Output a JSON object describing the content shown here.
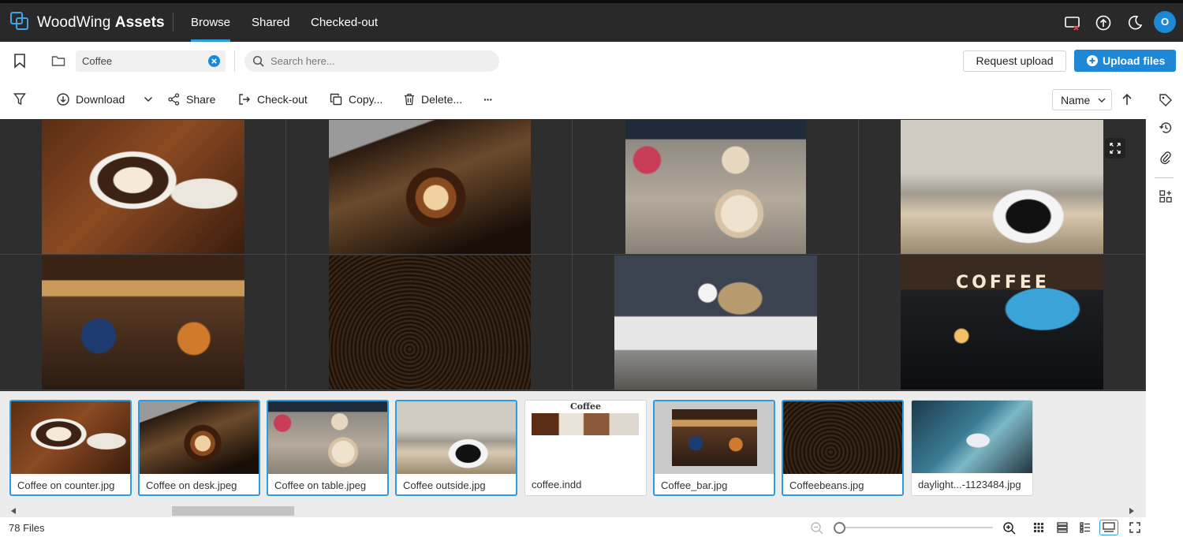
{
  "app": {
    "brand_regular": "WoodWing ",
    "brand_bold": "Assets",
    "nav": [
      {
        "label": "Browse",
        "active": true
      },
      {
        "label": "Shared",
        "active": false
      },
      {
        "label": "Checked-out",
        "active": false
      }
    ],
    "avatar_initial": "O",
    "accent_color": "#1e88d6",
    "icons": [
      "no-cast-icon",
      "upload-cloud-icon",
      "dark-mode-icon"
    ]
  },
  "search_row": {
    "folder_chip": "Coffee",
    "search_placeholder": "Search here...",
    "search_value": "",
    "request_upload": "Request upload",
    "upload_files": "Upload files"
  },
  "toolbar": {
    "download": "Download",
    "share": "Share",
    "checkout": "Check-out",
    "copy": "Copy...",
    "delete": "Delete...",
    "more": "···",
    "sort_by": "Name"
  },
  "preview_grid": {
    "banner_text": "COFFEE"
  },
  "filmstrip": [
    {
      "name": "Coffee on counter.jpg",
      "selected": true
    },
    {
      "name": "Coffee on desk.jpeg",
      "selected": true
    },
    {
      "name": "Coffee on table.jpeg",
      "selected": true
    },
    {
      "name": "Coffee outside.jpg",
      "selected": true
    },
    {
      "name": "coffee.indd",
      "selected": false,
      "thumb_heading": "Coffee"
    },
    {
      "name": "Coffee_bar.jpg",
      "selected": true
    },
    {
      "name": "Coffeebeans.jpg",
      "selected": true
    },
    {
      "name": "daylight...-1123484.jpg",
      "selected": false
    }
  ],
  "status": {
    "file_count": "78 Files",
    "zoom_fraction": 0
  }
}
